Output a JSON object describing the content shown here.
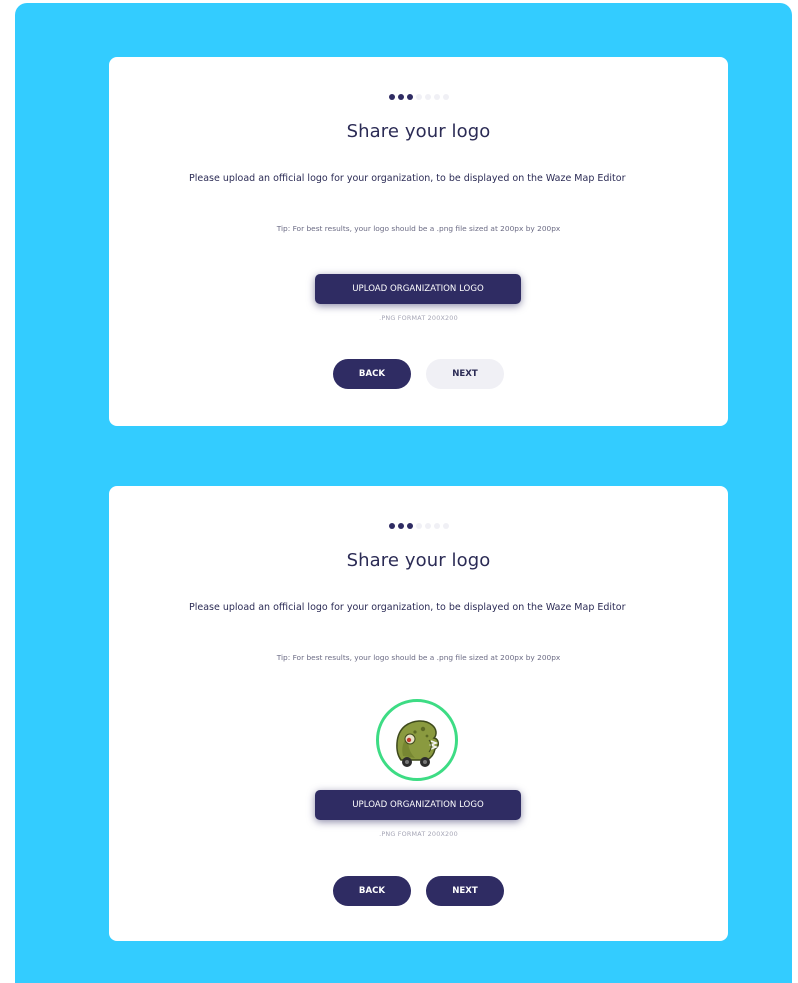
{
  "wizard": {
    "dot_count": 7,
    "active_dots": 3
  },
  "cards": [
    {
      "title": "Share your logo",
      "description": "Please upload an official logo for your organization, to be displayed on the Waze Map Editor",
      "tip": "Tip: For best results, your logo should be a .png file sized at 200px by 200px",
      "upload_label": "UPLOAD ORGANIZATION LOGO",
      "format_hint": ".PNG FORMAT 200X200",
      "back_label": "BACK",
      "next_label": "NEXT",
      "next_enabled": false,
      "has_logo_preview": false
    },
    {
      "title": "Share your logo",
      "description": "Please upload an official logo for your organization, to be displayed on the Waze Map Editor",
      "tip": "Tip: For best results, your logo should be a .png file sized at 200px by 200px",
      "upload_label": "UPLOAD ORGANIZATION LOGO",
      "format_hint": ".PNG FORMAT 200X200",
      "back_label": "BACK",
      "next_label": "NEXT",
      "next_enabled": true,
      "has_logo_preview": true,
      "logo_preview_icon": "waze-monster-logo"
    }
  ],
  "colors": {
    "background": "#33ccff",
    "primary": "#2f2c63",
    "disabled_button": "#f0f0f5",
    "logo_ring": "#3ddc84"
  }
}
